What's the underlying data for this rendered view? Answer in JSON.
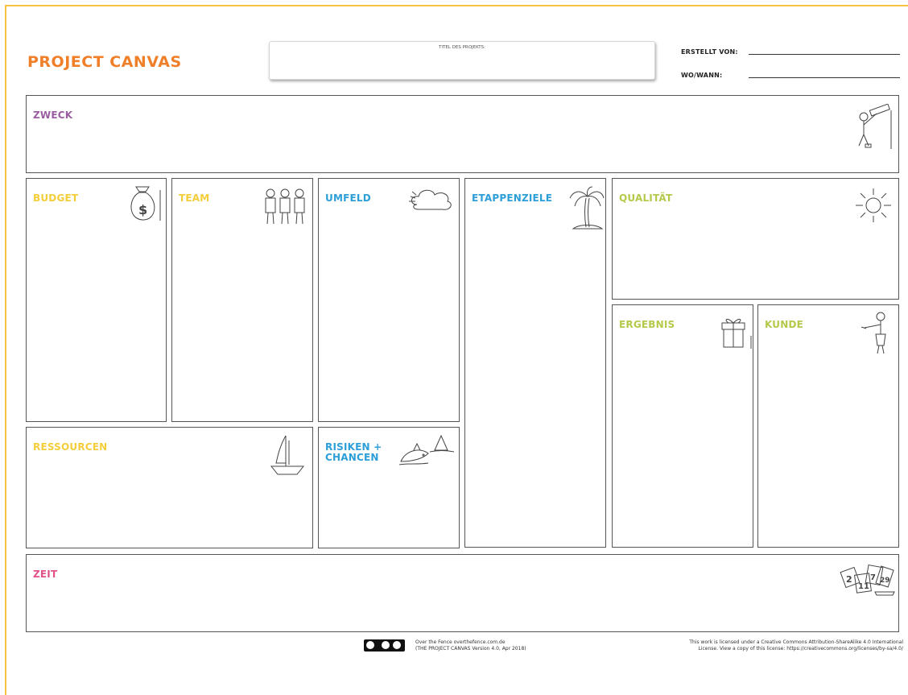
{
  "header": {
    "title": "PROJECT CANVAS",
    "project_title_label": "TITEL DES PROJEKTS:",
    "created_by_label": "ERSTELLT VON:",
    "where_when_label": "WO/WANN:"
  },
  "sections": {
    "zweck": "ZWECK",
    "budget": "BUDGET",
    "team": "TEAM",
    "umfeld": "UMFELD",
    "etappenziele": "ETAPPENZIELE",
    "qualitaet": "QUALITÄT",
    "ergebnis": "ERGEBNIS",
    "kunde": "KUNDE",
    "ressourcen": "RESSOURCEN",
    "risiken_line1": "RISIKEN +",
    "risiken_line2": "CHANCEN",
    "zeit": "ZEIT"
  },
  "footer": {
    "credit_line1": "Over the Fence overthefence.com.de",
    "credit_line2": "(THE PROJECT CANVAS Version 4.0, Apr 2018)",
    "license_line1": "This work is licensed under a Creative Commons Attribution-ShareAlike 4.0 International",
    "license_line2": "License. View a copy of this license: https://creativecommons.org/licenses/by-sa/4.0/"
  },
  "colors": {
    "title_orange": "#f07f2a",
    "frame_yellow": "#f6c343",
    "purple": "#9a5ea0",
    "yellow": "#f4ce3a",
    "blue": "#2d9fd8",
    "green": "#b5c94a",
    "pink": "#e2508a"
  },
  "icons": {
    "zweck": "telescope-person-icon",
    "budget": "money-bag-icon",
    "team": "people-group-icon",
    "umfeld": "cloud-icon",
    "etappenziele": "palm-island-icon",
    "qualitaet": "sun-icon",
    "ergebnis": "gift-icon",
    "kunde": "person-icon",
    "ressourcen": "sailboat-icon",
    "risiken": "dolphin-shark-icon",
    "zeit": "calendar-cards-icon",
    "license": "cc-by-sa-badge"
  }
}
